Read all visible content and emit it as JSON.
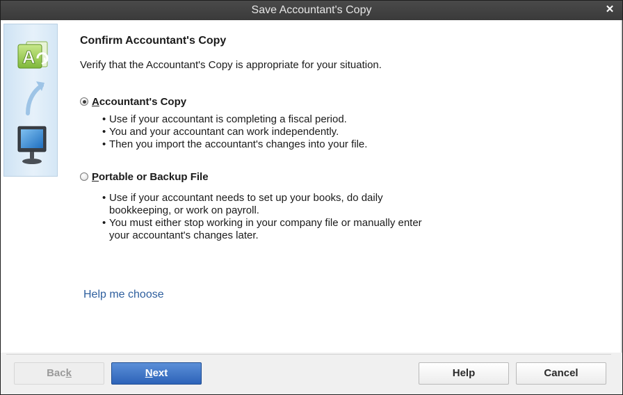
{
  "window": {
    "title": "Save Accountant's Copy",
    "close_glyph": "✕"
  },
  "side_panel": {
    "icons": [
      "accountant-copy-document-icon",
      "curved-arrow-icon",
      "computer-monitor-icon"
    ]
  },
  "main": {
    "heading": "Confirm Accountant's Copy",
    "subtext": "Verify that the Accountant's Copy is appropriate for your situation.",
    "options": [
      {
        "label_underlined": "A",
        "label_rest": "ccountant's Copy",
        "selected": true,
        "bullets": [
          "Use if your accountant is completing a fiscal period.",
          "You and your accountant can work independently.",
          "Then you import the accountant's changes into your file."
        ]
      },
      {
        "label_underlined": "P",
        "label_rest": "ortable or Backup File",
        "selected": false,
        "bullets": [
          {
            "line1": "Use if your accountant needs to set up your books, do daily",
            "line2": "bookkeeping, or work on payroll."
          },
          {
            "line1": "You must either stop working in your company file or manually enter",
            "line2": "your accountant's changes later."
          }
        ]
      }
    ],
    "help_link": "Help me choose"
  },
  "footer": {
    "back": {
      "pre": "Bac",
      "underlined": "k",
      "post": "",
      "enabled": false
    },
    "next": {
      "pre": "",
      "underlined": "N",
      "post": "ext",
      "enabled": true
    },
    "help": "Help",
    "cancel": "Cancel"
  },
  "colors": {
    "titlebar": "#3a3a3a",
    "next_button": "#2d63b8",
    "link": "#2e5f9e"
  }
}
